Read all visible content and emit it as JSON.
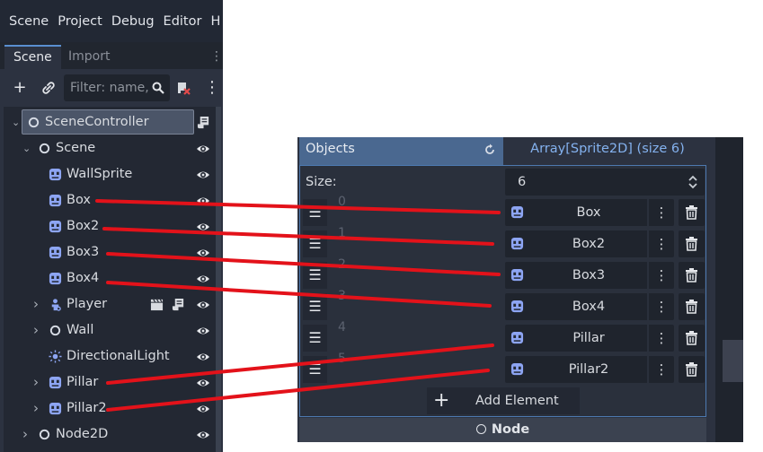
{
  "menu": [
    "Scene",
    "Project",
    "Debug",
    "Editor",
    "H"
  ],
  "dock_tabs": {
    "scene": "Scene",
    "import": "Import"
  },
  "filter": {
    "placeholder": "Filter: name,"
  },
  "tree": [
    {
      "label": "SceneController",
      "icon": "node-icon",
      "depth": 0,
      "arrow": "down",
      "selected": true,
      "script": true
    },
    {
      "label": "Scene",
      "icon": "node-icon",
      "depth": 1,
      "arrow": "down"
    },
    {
      "label": "WallSprite",
      "icon": "sprite-icon",
      "depth": 2
    },
    {
      "label": "Box",
      "icon": "sprite-icon",
      "depth": 2
    },
    {
      "label": "Box2",
      "icon": "sprite-icon",
      "depth": 2
    },
    {
      "label": "Box3",
      "icon": "sprite-icon",
      "depth": 2
    },
    {
      "label": "Box4",
      "icon": "sprite-icon",
      "depth": 2
    },
    {
      "label": "Player",
      "icon": "character-icon",
      "depth": 2,
      "arrow": "right",
      "clapper": true,
      "script": true
    },
    {
      "label": "Wall",
      "icon": "node-icon",
      "depth": 2,
      "arrow": "right"
    },
    {
      "label": "DirectionalLight",
      "icon": "light-icon",
      "depth": 2
    },
    {
      "label": "Pillar",
      "icon": "sprite-icon",
      "depth": 2,
      "arrow": "right"
    },
    {
      "label": "Pillar2",
      "icon": "sprite-icon",
      "depth": 2,
      "arrow": "right"
    },
    {
      "label": "Node2D",
      "icon": "node-icon",
      "depth": 1,
      "arrow": "right"
    }
  ],
  "inspector": {
    "property_name": "Objects",
    "array_type": "Array[Sprite2D] (size 6)",
    "size_label": "Size:",
    "size_value": "6",
    "elements": [
      {
        "index": "0",
        "name": "Box"
      },
      {
        "index": "1",
        "name": "Box2"
      },
      {
        "index": "2",
        "name": "Box3"
      },
      {
        "index": "3",
        "name": "Box4"
      },
      {
        "index": "4",
        "name": "Pillar"
      },
      {
        "index": "5",
        "name": "Pillar2"
      }
    ],
    "add_element": "Add Element",
    "footer": "Node"
  },
  "colors": {
    "accent_blue": "#4a6890",
    "sprite_icon": "#8da5f3",
    "annotation_line": "#e3121a"
  }
}
